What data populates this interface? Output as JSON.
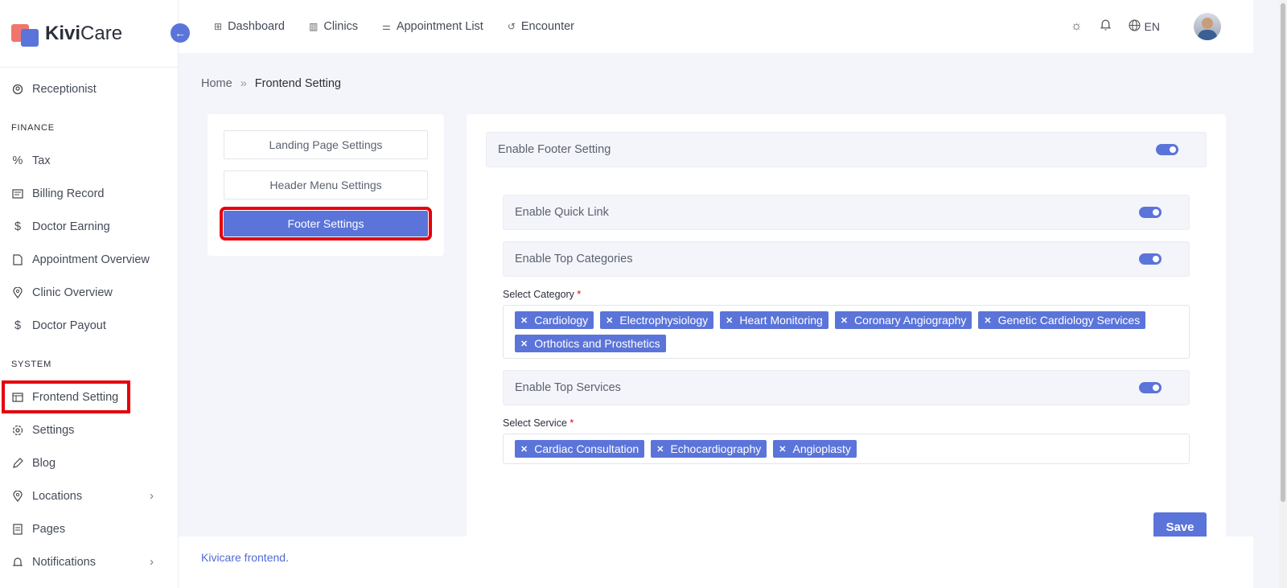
{
  "brand": {
    "name_bold": "Kivi",
    "name_rest": "Care"
  },
  "sidebar": {
    "items_top": [
      {
        "label": "Receptionist",
        "icon": "receptionist-icon"
      }
    ],
    "section_finance": "FINANCE",
    "finance_items": [
      {
        "label": "Tax",
        "icon": "percent-icon"
      },
      {
        "label": "Billing Record",
        "icon": "billing-icon"
      },
      {
        "label": "Doctor Earning",
        "icon": "dollar-icon"
      },
      {
        "label": "Appointment Overview",
        "icon": "document-icon"
      },
      {
        "label": "Clinic Overview",
        "icon": "location-pin-icon"
      },
      {
        "label": "Doctor Payout",
        "icon": "dollar-icon"
      }
    ],
    "section_system": "SYSTEM",
    "system_items": [
      {
        "label": "Frontend Setting",
        "icon": "layout-icon"
      },
      {
        "label": "Settings",
        "icon": "gear-icon"
      },
      {
        "label": "Blog",
        "icon": "pencil-icon"
      },
      {
        "label": "Locations",
        "icon": "location-icon"
      },
      {
        "label": "Pages",
        "icon": "pages-icon"
      },
      {
        "label": "Notifications",
        "icon": "bell-icon"
      }
    ]
  },
  "topnav": {
    "links": [
      {
        "label": "Dashboard",
        "icon": "grid-icon"
      },
      {
        "label": "Clinics",
        "icon": "building-icon"
      },
      {
        "label": "Appointment List",
        "icon": "sliders-icon"
      },
      {
        "label": "Encounter",
        "icon": "history-icon"
      }
    ],
    "lang": "EN"
  },
  "breadcrumb": {
    "home": "Home",
    "current": "Frontend Setting"
  },
  "settings_menu": {
    "landing": "Landing Page Settings",
    "header": "Header Menu Settings",
    "footer": "Footer Settings"
  },
  "panel": {
    "enable_footer": "Enable Footer Setting",
    "enable_quick_link": "Enable Quick Link",
    "enable_top_categories": "Enable Top Categories",
    "select_category_label": "Select Category",
    "categories": [
      "Cardiology",
      "Electrophysiology",
      "Heart Monitoring",
      "Coronary Angiography",
      "Genetic Cardiology Services",
      "Orthotics and Prosthetics"
    ],
    "enable_top_services": "Enable Top Services",
    "select_service_label": "Select Service",
    "services": [
      "Cardiac Consultation",
      "Echocardiography",
      "Angioplasty"
    ],
    "required_mark": "*",
    "save": "Save"
  },
  "footer": {
    "link": "Kivicare frontend",
    "suffix": "."
  },
  "colors": {
    "accent": "#5b74d9",
    "highlight": "#e5000b"
  }
}
